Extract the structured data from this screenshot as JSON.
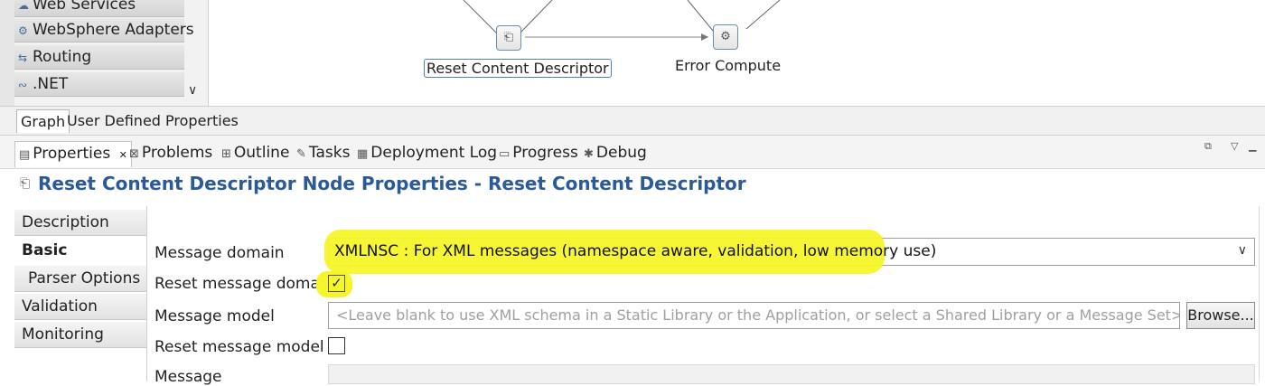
{
  "palette": {
    "items": [
      {
        "label": "Web Services",
        "icon": "globe-icon"
      },
      {
        "label": "WebSphere Adapters",
        "icon": "adapter-icon"
      },
      {
        "label": "Routing",
        "icon": "routing-icon"
      },
      {
        "label": ".NET",
        "icon": "dotnet-icon"
      }
    ]
  },
  "canvas": {
    "nodes": [
      {
        "label": "Reset Content Descriptor",
        "icon": "reset-descriptor-icon",
        "selected": true
      },
      {
        "label": "Error Compute",
        "icon": "compute-icon",
        "selected": false
      }
    ]
  },
  "editor_tabs": [
    "Graph",
    "User Defined Properties"
  ],
  "view_tabs": [
    {
      "label": "Properties",
      "icon": "properties-icon",
      "closable": true,
      "close": "✕"
    },
    {
      "label": "Problems",
      "icon": "problems-icon"
    },
    {
      "label": "Outline",
      "icon": "outline-icon"
    },
    {
      "label": "Tasks",
      "icon": "tasks-icon"
    },
    {
      "label": "Deployment Log",
      "icon": "log-icon"
    },
    {
      "label": "Progress",
      "icon": "progress-icon"
    },
    {
      "label": "Debug",
      "icon": "debug-icon"
    }
  ],
  "properties": {
    "title": "Reset Content Descriptor Node Properties - Reset Content Descriptor",
    "nav": [
      "Description",
      "Basic",
      "Parser Options",
      "Validation",
      "Monitoring"
    ],
    "active_nav": "Basic",
    "fields": {
      "message_domain_label": "Message domain",
      "message_domain_value": "XMLNSC : For XML messages (namespace aware, validation, low memory use)",
      "reset_domain_label": "Reset message domain",
      "reset_domain_checked": true,
      "message_model_label": "Message model",
      "message_model_placeholder": "<Leave blank to use XML schema in a Static Library or the Application, or select a Shared Library or a Message Set>",
      "browse_label": "Browse...",
      "reset_model_label": "Reset message model",
      "reset_model_checked": false,
      "message_label": "Message"
    }
  },
  "colors": {
    "highlight": "#f5f52a",
    "title": "#2a5a9a",
    "selection": "#4f7fc0"
  }
}
